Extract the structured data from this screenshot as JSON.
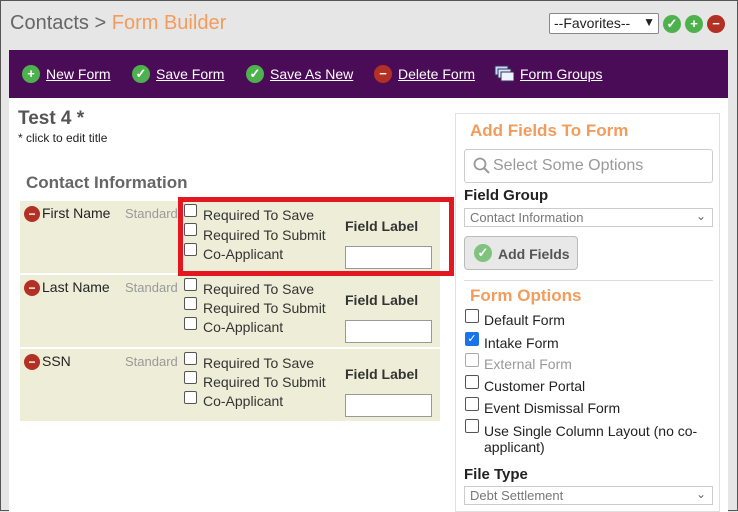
{
  "breadcrumb": {
    "parent": "Contacts",
    "separator": ">",
    "current": "Form Builder"
  },
  "favorites": {
    "selected": "--Favorites--"
  },
  "toolbar": {
    "new_form": "New Form",
    "save_form": "Save Form",
    "save_as_new": "Save As New",
    "delete_form": "Delete Form",
    "form_groups": "Form Groups"
  },
  "form": {
    "title": "Test 4 *",
    "edit_hint": "* click to edit title"
  },
  "section": {
    "title": "Contact Information"
  },
  "fields": [
    {
      "name": "First Name",
      "type": "Standard",
      "opt_save": "Required To Save",
      "opt_submit": "Required To Submit",
      "opt_coapp": "Co-Applicant",
      "label_caption": "Field Label",
      "label_value": ""
    },
    {
      "name": "Last Name",
      "type": "Standard",
      "opt_save": "Required To Save",
      "opt_submit": "Required To Submit",
      "opt_coapp": "Co-Applicant",
      "label_caption": "Field Label",
      "label_value": ""
    },
    {
      "name": "SSN",
      "type": "Standard",
      "opt_save": "Required To Save",
      "opt_submit": "Required To Submit",
      "opt_coapp": "Co-Applicant",
      "label_caption": "Field Label",
      "label_value": ""
    }
  ],
  "side": {
    "add_title": "Add Fields To Form",
    "search_placeholder": "Select Some Options",
    "field_group_label": "Field Group",
    "field_group_value": "Contact Information",
    "add_button": "Add Fields",
    "options_title": "Form Options",
    "options": [
      {
        "label": "Default Form",
        "checked": false,
        "disabled": false
      },
      {
        "label": "Intake Form",
        "checked": true,
        "disabled": false
      },
      {
        "label": "External Form",
        "checked": false,
        "disabled": true
      },
      {
        "label": "Customer Portal",
        "checked": false,
        "disabled": false
      },
      {
        "label": "Event Dismissal Form",
        "checked": false,
        "disabled": false
      },
      {
        "label": "Use Single Column Layout (no co-",
        "label2": "applicant)",
        "checked": false,
        "disabled": false
      }
    ],
    "file_type_label": "File Type",
    "file_type_value": "Debt Settlement"
  },
  "colors": {
    "accent": "#f39c5c",
    "toolbar": "#4b0c57",
    "highlight": "#e3171f",
    "row_bg": "#eeeed8"
  }
}
